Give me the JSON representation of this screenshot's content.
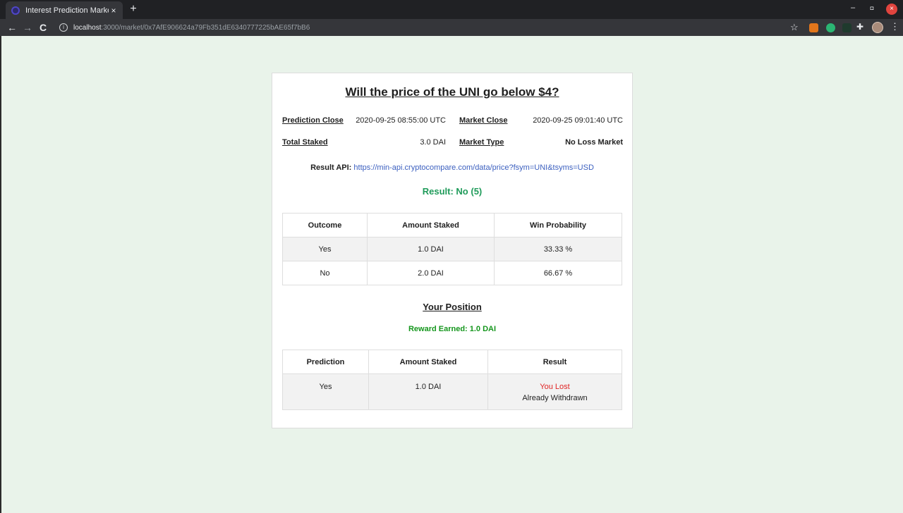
{
  "browser": {
    "tab_title": "Interest Prediction Marke",
    "tab_close": "×",
    "new_tab": "+",
    "url_host": "localhost",
    "url_rest": ":3000/market/0x7AfE906624a79Fb351dE6340777225bAE65f7bB6",
    "back": "←",
    "forward": "→",
    "reload": "C",
    "bookmark": "☆",
    "extensions": "✚",
    "menu": "⋮",
    "minimize": "–",
    "restore": "◘",
    "close": "×"
  },
  "market": {
    "title": "Will the price of the UNI go below $4?",
    "prediction_close_label": "Prediction Close",
    "prediction_close_value": "2020-09-25 08:55:00 UTC",
    "market_close_label": "Market Close",
    "market_close_value": "2020-09-25 09:01:40 UTC",
    "total_staked_label": "Total Staked",
    "total_staked_value": "3.0 DAI",
    "market_type_label": "Market Type",
    "market_type_value": "No Loss Market",
    "result_api_label": "Result API:",
    "result_api_url": "https://min-api.cryptocompare.com/data/price?fsym=UNI&tsyms=USD",
    "result": "Result: No (5)"
  },
  "outcomes_table": {
    "headers": [
      "Outcome",
      "Amount Staked",
      "Win Probability"
    ],
    "rows": [
      [
        "Yes",
        "1.0 DAI",
        "33.33 %"
      ],
      [
        "No",
        "2.0 DAI",
        "66.67 %"
      ]
    ]
  },
  "position": {
    "heading": "Your Position",
    "reward": "Reward Earned: 1.0 DAI",
    "headers": [
      "Prediction",
      "Amount Staked",
      "Result"
    ],
    "rows": [
      {
        "prediction": "Yes",
        "amount": "1.0 DAI",
        "result": "You Lost",
        "status": "Already Withdrawn"
      }
    ]
  },
  "colors": {
    "page_bg": "#e9f3ea",
    "result_green": "#1f9b5a",
    "reward_green": "#14961c",
    "lost_red": "#e02424",
    "link_blue": "#3b5fbf"
  }
}
